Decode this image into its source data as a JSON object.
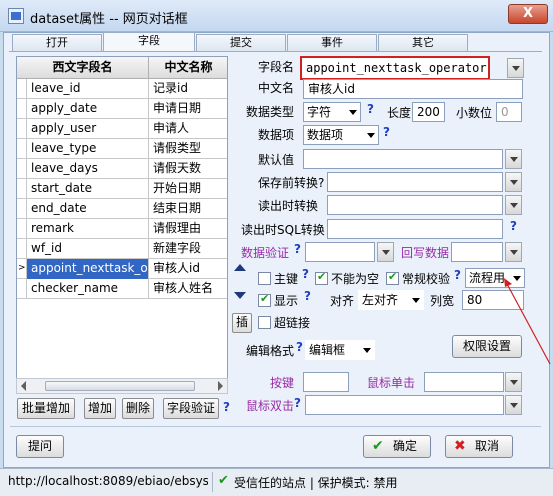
{
  "window": {
    "title": "dataset属性 -- 网页对话框",
    "close_label": "X"
  },
  "tabs": [
    "打开",
    "字段",
    "提交",
    "事件",
    "其它"
  ],
  "active_tab": "字段",
  "field_table": {
    "headers": [
      "西文字段名",
      "中文名称"
    ],
    "rows": [
      {
        "marker": "",
        "en": "leave_id",
        "cn": "记录id"
      },
      {
        "marker": "",
        "en": "apply_date",
        "cn": "申请日期"
      },
      {
        "marker": "",
        "en": "apply_user",
        "cn": "申请人"
      },
      {
        "marker": "",
        "en": "leave_type",
        "cn": "请假类型"
      },
      {
        "marker": "",
        "en": "leave_days",
        "cn": "请假天数"
      },
      {
        "marker": "",
        "en": "start_date",
        "cn": "开始日期"
      },
      {
        "marker": "",
        "en": "end_date",
        "cn": "结束日期"
      },
      {
        "marker": "",
        "en": "remark",
        "cn": "请假理由"
      },
      {
        "marker": "",
        "en": "wf_id",
        "cn": "新建字段"
      },
      {
        "marker": ">",
        "en": "appoint_nexttask_o",
        "cn": "审核人id"
      },
      {
        "marker": "",
        "en": "checker_name",
        "cn": "审核人姓名"
      }
    ],
    "selected_index": 9
  },
  "left_buttons": {
    "batch_add": "批量增加",
    "add": "增加",
    "delete": "删除",
    "validate": "字段验证",
    "help": "?"
  },
  "form": {
    "field_name_label": "字段名",
    "field_name_value": "appoint_nexttask_operator",
    "cn_name_label": "中文名",
    "cn_name_value": "审核人id",
    "data_type_label": "数据类型",
    "data_type_value": "字符",
    "length_label": "长度",
    "length_value": "200",
    "decimals_label": "小数位",
    "decimals_value": "0",
    "data_item_label": "数据项",
    "data_item_value": "数据项",
    "default_label": "默认值",
    "pre_save_label": "保存前转换?",
    "on_read_label": "读出时转换",
    "sql_read_label": "读出时SQL转换",
    "validate_label": "数据验证",
    "writeback_label": "回写数据",
    "primary_key_label": "主键",
    "not_null_label": "不能为空",
    "normal_check_label": "常规校验",
    "process_use_value": "流程用",
    "display_label": "显示",
    "align_label": "对齐",
    "align_value": "左对齐",
    "col_width_label": "列宽",
    "col_width_value": "80",
    "insert_label": "插",
    "hyperlink_label": "超链接",
    "edit_format_label": "编辑格式",
    "edit_format_value": "编辑框",
    "permission_button": "权限设置",
    "hotkey_label": "按键",
    "mouse_click_label": "鼠标单击",
    "mouse_dblclick_label": "鼠标双击",
    "help": "?"
  },
  "bottom_buttons": {
    "hint": "提问",
    "ok": "确定",
    "cancel": "取消"
  },
  "status_bar": {
    "url": "http://localhost:8089/ebiao/ebsys",
    "zone": "受信任的站点 | 保护模式: 禁用"
  },
  "colors": {
    "accent": "#3166c4",
    "highlight_border": "#d02020",
    "purple_label": "#9a2aa8"
  }
}
